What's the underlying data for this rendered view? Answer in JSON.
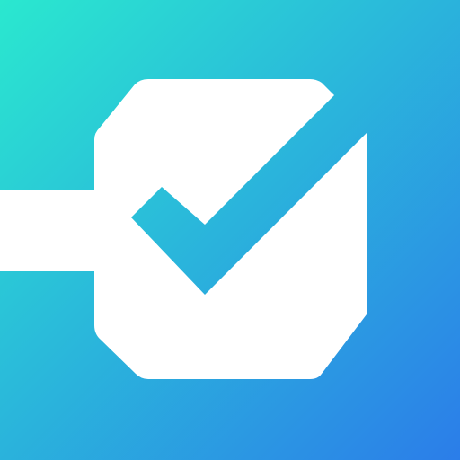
{
  "icon": {
    "name": "checkbox-app-icon",
    "colors": {
      "gradient_start": "#2ae8cf",
      "gradient_end": "#2b7de9",
      "shape_fill": "#ffffff"
    }
  }
}
